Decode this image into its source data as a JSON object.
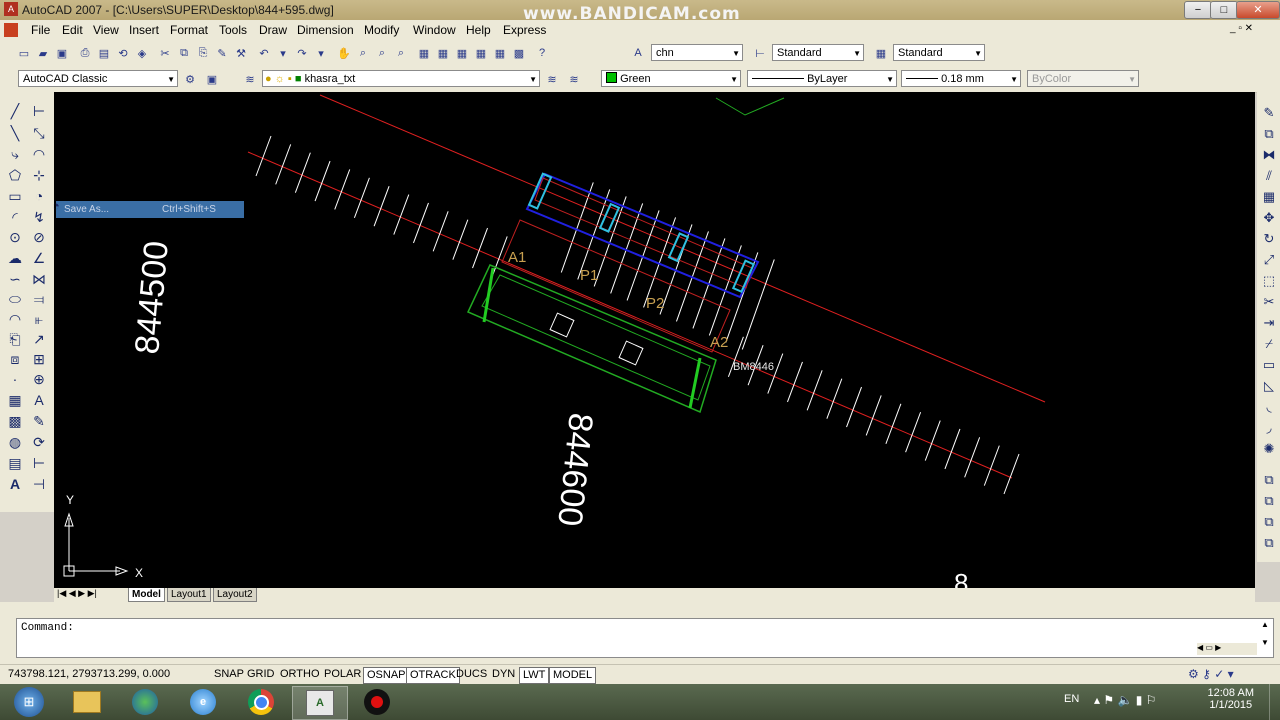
{
  "window": {
    "title": "AutoCAD 2007 - [C:\\Users\\SUPER\\Desktop\\844+595.dwg]",
    "watermark": "www.BANDICAM.com",
    "minimize": "−",
    "restore": "□",
    "close": "✕"
  },
  "menu": [
    "File",
    "Edit",
    "View",
    "Insert",
    "Format",
    "Tools",
    "Draw",
    "Dimension",
    "Modify",
    "Window",
    "Help",
    "Express"
  ],
  "toolbar": {
    "text_style": "chn",
    "dim_style": "Standard",
    "table_style": "Standard",
    "workspace": "AutoCAD Classic",
    "layer": "khasra_txt",
    "color": "Green",
    "color_swatch": "#00c000",
    "linetype": "ByLayer",
    "lineweight": "0.18 mm",
    "plotstyle": "ByColor"
  },
  "context_menu": {
    "item": "Save As...",
    "shortcut": "Ctrl+Shift+S"
  },
  "drawing": {
    "chainage_labels": [
      "844500",
      "844600"
    ],
    "point_labels": [
      "A1",
      "P1",
      "P2",
      "A2"
    ],
    "bm_label": "BM8446",
    "partial_label": "8",
    "ucs_x": "X",
    "ucs_y": "Y"
  },
  "tabs": [
    "Model",
    "Layout1",
    "Layout2"
  ],
  "command": {
    "prompt": "Command:"
  },
  "status": {
    "coords": "743798.121, 2793713.299, 0.000",
    "toggles": [
      "SNAP",
      "GRID",
      "ORTHO",
      "POLAR",
      "OSNAP",
      "OTRACK",
      "DUCS",
      "DYN",
      "LWT",
      "MODEL"
    ],
    "on": [
      "OSNAP",
      "OTRACK",
      "LWT",
      "MODEL"
    ]
  },
  "taskbar": {
    "lang": "EN",
    "time": "12:08 AM",
    "date": "1/1/2015"
  }
}
